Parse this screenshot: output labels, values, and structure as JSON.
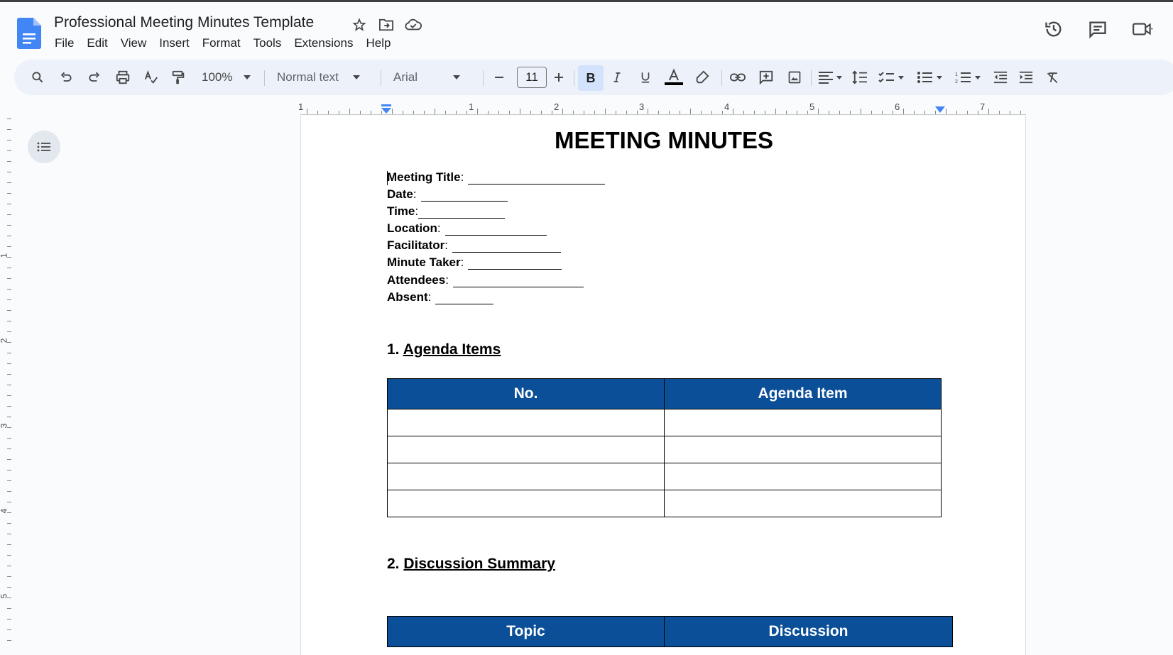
{
  "app": {
    "doc_title": "Professional Meeting Minutes Template",
    "menu": [
      "File",
      "Edit",
      "View",
      "Insert",
      "Format",
      "Tools",
      "Extensions",
      "Help"
    ]
  },
  "toolbar": {
    "zoom": "100%",
    "style": "Normal text",
    "font": "Arial",
    "font_size": "11",
    "bold_label": "B"
  },
  "ruler": {
    "labels": [
      "1",
      "1",
      "2",
      "3",
      "4",
      "5",
      "6",
      "7"
    ],
    "vertical_labels": [
      "1",
      "2",
      "3",
      "4",
      "5"
    ]
  },
  "document": {
    "heading": "MEETING MINUTES",
    "fields": [
      {
        "label": "Meeting Title",
        "suffix": ":"
      },
      {
        "label": "Date",
        "suffix": ":"
      },
      {
        "label": "Time",
        "suffix": ":"
      },
      {
        "label": "Location",
        "suffix": ":"
      },
      {
        "label": "Facilitator",
        "suffix": ":"
      },
      {
        "label": "Minute Taker",
        "suffix": ":"
      },
      {
        "label": "Attendees",
        "suffix": ":"
      },
      {
        "label": "Absent",
        "suffix": ":"
      }
    ],
    "section1": {
      "number": "1.",
      "title": "Agenda Items"
    },
    "agenda_table": {
      "headers": [
        "No.",
        "Agenda Item"
      ],
      "empty_rows": 4
    },
    "section2": {
      "number": "2.",
      "title": "Discussion Summary"
    },
    "discussion_table": {
      "headers": [
        "Topic",
        "Discussion"
      ]
    }
  },
  "colors": {
    "table_header": "#0b4f99",
    "docs_blue": "#4285f4"
  }
}
